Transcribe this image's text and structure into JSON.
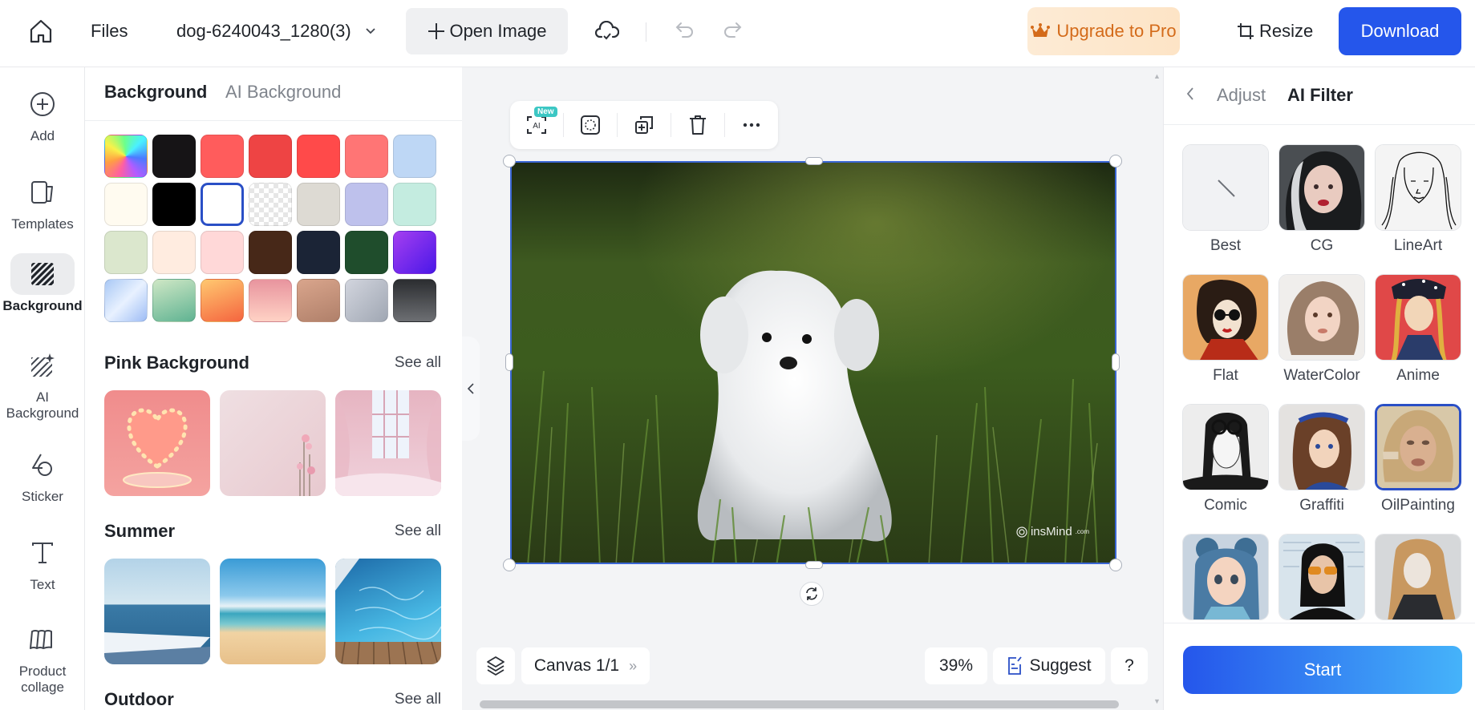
{
  "topbar": {
    "home_icon": "home-icon",
    "files_label": "Files",
    "filename": "dog-6240043_1280(3)",
    "open_image_label": "Open Image",
    "upgrade_label": "Upgrade to Pro",
    "resize_label": "Resize",
    "download_label": "Download",
    "colors": {
      "download_bg": "#2556eb",
      "upgrade_text": "#d46b1a"
    }
  },
  "leftnav": {
    "items": [
      {
        "label": "Add",
        "icon": "plus-circle-icon"
      },
      {
        "label": "Templates",
        "icon": "templates-icon"
      },
      {
        "label": "Background",
        "icon": "background-hatch-icon",
        "active": true
      },
      {
        "label": "AI Background",
        "icon": "ai-background-icon"
      },
      {
        "label": "Sticker",
        "icon": "sticker-shapes-icon"
      },
      {
        "label": "Text",
        "icon": "text-icon"
      },
      {
        "label": "Product collage",
        "icon": "collage-icon"
      }
    ]
  },
  "bgpanel": {
    "tabs": [
      "Background",
      "AI Background"
    ],
    "active_tab": "Background",
    "swatches": [
      "conic-gradient(from 200deg at 50% 50%, #ff5fa2, #ff9f43, #f8f24a, #6dff8a, #4af0ff, #4a7bff, #b25cff, #ff5fa2)",
      "#161416",
      "#ff5c5c",
      "#ee4444",
      "#ff4a4a",
      "#ff7575",
      "#bed7f5",
      "#fffbf0",
      "#000000",
      "#ffffff",
      "checker",
      "#dddad3",
      "#bec1ec",
      "#c4ece0",
      "#dbe7cd",
      "#ffece0",
      "#ffd8d8",
      "#472818",
      "#1b2436",
      "#1f4d2c",
      "linear-gradient(135deg,#a53ff0,#4a18e8)",
      "linear-gradient(135deg,#a9c8f5,#e8f1ff 50%,#9dbcf5)",
      "linear-gradient(160deg,#cfe7c5,#5fb392)",
      "linear-gradient(160deg,#ffc870,#f5653f)",
      "linear-gradient(180deg,#e8949e,#ffd2c5)",
      "linear-gradient(160deg,#d9a58c,#b0806a)",
      "linear-gradient(135deg,#d2d5de,#a0a7b3)",
      "linear-gradient(180deg,#2b2d30,#6d6f73)"
    ],
    "selected_swatch": 9,
    "sections": [
      {
        "title": "Pink Background",
        "see_all": "See all",
        "thumbs": [
          "heart-lights",
          "pink-wall-flower",
          "pink-window-room"
        ]
      },
      {
        "title": "Summer",
        "see_all": "See all",
        "thumbs": [
          "ocean-horizon",
          "sandy-beach",
          "pool-water-deck"
        ]
      },
      {
        "title": "Outdoor",
        "see_all": "See all",
        "thumbs": []
      }
    ]
  },
  "canvas": {
    "new_badge": "New",
    "toolbar_icons": [
      "ai-select-icon",
      "cutout-icon",
      "duplicate-icon",
      "trash-icon",
      "more-icon"
    ],
    "image_alt": "White puppy sitting in grass",
    "watermark": "insMind",
    "watermark_suffix": ".com",
    "canvas_label": "Canvas 1/1",
    "zoom_level": "39%",
    "suggest_label": "Suggest",
    "help_label": "?"
  },
  "rightpanel": {
    "tabs": [
      "Adjust",
      "AI Filter"
    ],
    "active_tab": "AI Filter",
    "filters": [
      {
        "label": "Best",
        "style": "none"
      },
      {
        "label": "CG",
        "style": "cg"
      },
      {
        "label": "LineArt",
        "style": "lineart"
      },
      {
        "label": "Flat",
        "style": "flat"
      },
      {
        "label": "WaterColor",
        "style": "watercolor"
      },
      {
        "label": "Anime",
        "style": "anime"
      },
      {
        "label": "Comic",
        "style": "comic"
      },
      {
        "label": "Graffiti",
        "style": "graffiti"
      },
      {
        "label": "OilPainting",
        "style": "oil",
        "selected": true
      },
      {
        "label": "",
        "style": "3d"
      },
      {
        "label": "",
        "style": "sunglasses"
      },
      {
        "label": "",
        "style": "sketch"
      }
    ],
    "start_label": "Start"
  }
}
